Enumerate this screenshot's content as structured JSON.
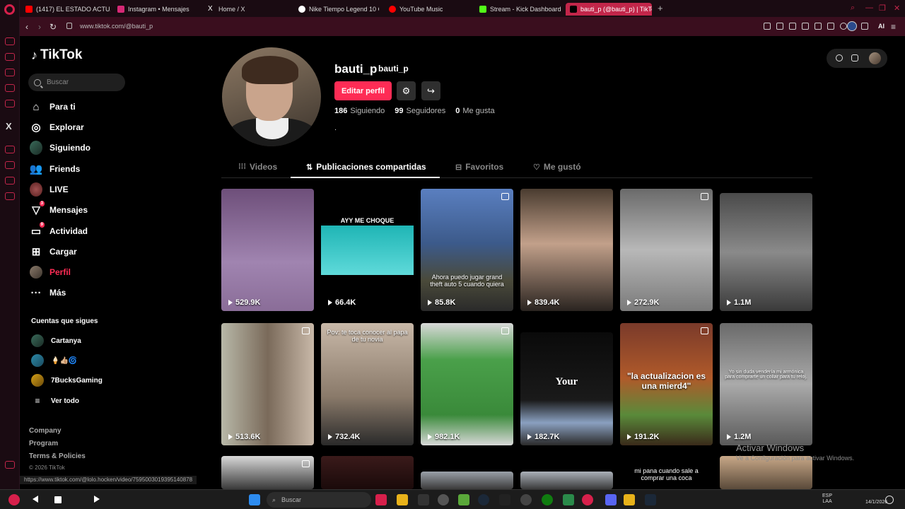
{
  "browser": {
    "tabs": [
      {
        "label": "(1417) EL ESTADO ACTUAL",
        "color": "#ff0000"
      },
      {
        "label": "Instagram • Mensajes",
        "color": "#d62976"
      },
      {
        "label": "Home / X",
        "color": "#ffffff"
      },
      {
        "label": "Nike Tiempo Legend 10 C",
        "color": "#ffffff"
      },
      {
        "label": "YouTube Music",
        "color": "#ff0000"
      },
      {
        "label": "Stream - Kick Dashboard",
        "color": "#53fc18"
      },
      {
        "label": "bauti_p (@bauti_p) | TikTok",
        "color": "#000000"
      }
    ],
    "new_tab": "+",
    "url": "www.tiktok.com/@bauti_p",
    "ai_label": "AI"
  },
  "sidebar": {
    "logo": "TikTok",
    "search_placeholder": "Buscar",
    "nav": [
      {
        "label": "Para ti",
        "icon": "home-icon"
      },
      {
        "label": "Explorar",
        "icon": "compass-icon"
      },
      {
        "label": "Siguiendo",
        "icon": "following-avatar-icon"
      },
      {
        "label": "Friends",
        "icon": "friends-icon"
      },
      {
        "label": "LIVE",
        "icon": "live-icon"
      },
      {
        "label": "Mensajes",
        "icon": "messages-icon",
        "badge": "3"
      },
      {
        "label": "Actividad",
        "icon": "activity-icon",
        "badge": "9"
      },
      {
        "label": "Cargar",
        "icon": "upload-icon"
      },
      {
        "label": "Perfil",
        "icon": "profile-avatar-icon"
      },
      {
        "label": "Más",
        "icon": "more-icon"
      }
    ],
    "following_title": "Cuentas que sigues",
    "following": [
      {
        "name": "Cartanya"
      },
      {
        "name": "🍦👍🏼🌀"
      },
      {
        "name": "7BucksGaming"
      }
    ],
    "see_all": "Ver todo",
    "footer": [
      "Company",
      "Program",
      "Terms & Policies"
    ],
    "copyright": "© 2026 TikTok"
  },
  "profile": {
    "username": "bauti_p",
    "nickname": "bauti_p",
    "edit_label": "Editar perfil",
    "following_count": "186",
    "following_label": "Siguiendo",
    "followers_count": "99",
    "followers_label": "Seguidores",
    "likes_count": "0",
    "likes_label": "Me gusta",
    "bio": "."
  },
  "tabs": [
    {
      "label": "Videos"
    },
    {
      "label": "Publicaciones compartidas"
    },
    {
      "label": "Favoritos"
    },
    {
      "label": "Me gustó"
    }
  ],
  "videos": [
    {
      "views": "529.9K",
      "caption": ""
    },
    {
      "views": "66.4K",
      "caption": "AYY ME CHOQUE"
    },
    {
      "views": "85.8K",
      "caption": "Ahora puedo jugar grand theft auto 5 cuando quiera"
    },
    {
      "views": "839.4K",
      "caption": ""
    },
    {
      "views": "272.9K",
      "caption": ""
    },
    {
      "views": "1.1M",
      "caption": ""
    },
    {
      "views": "513.6K",
      "caption": ""
    },
    {
      "views": "732.4K",
      "caption": "Pov: te toca conocer al papa de tu novia"
    },
    {
      "views": "982.1K",
      "caption": ""
    },
    {
      "views": "182.7K",
      "caption": "Your"
    },
    {
      "views": "191.2K",
      "caption": "\"la actualizacion es una mierd4\""
    },
    {
      "views": "1.2M",
      "caption": "Yo sin duda vendería mi armónica para comprarte un collar para tu reloj."
    }
  ],
  "bottom_caption": "mi pana cuando sale a comprar una coca",
  "overlay": {
    "activate_title": "Activar Windows",
    "activate_sub": "Ve a Configuración para activar Windows.",
    "status_url": "https://www.tiktok.com/@lolo.hocken/video/7595003019395140878"
  },
  "taskbar": {
    "search_label": "Buscar",
    "lang": "ESP",
    "lang2": "LAA",
    "time": "14/1/2026"
  }
}
